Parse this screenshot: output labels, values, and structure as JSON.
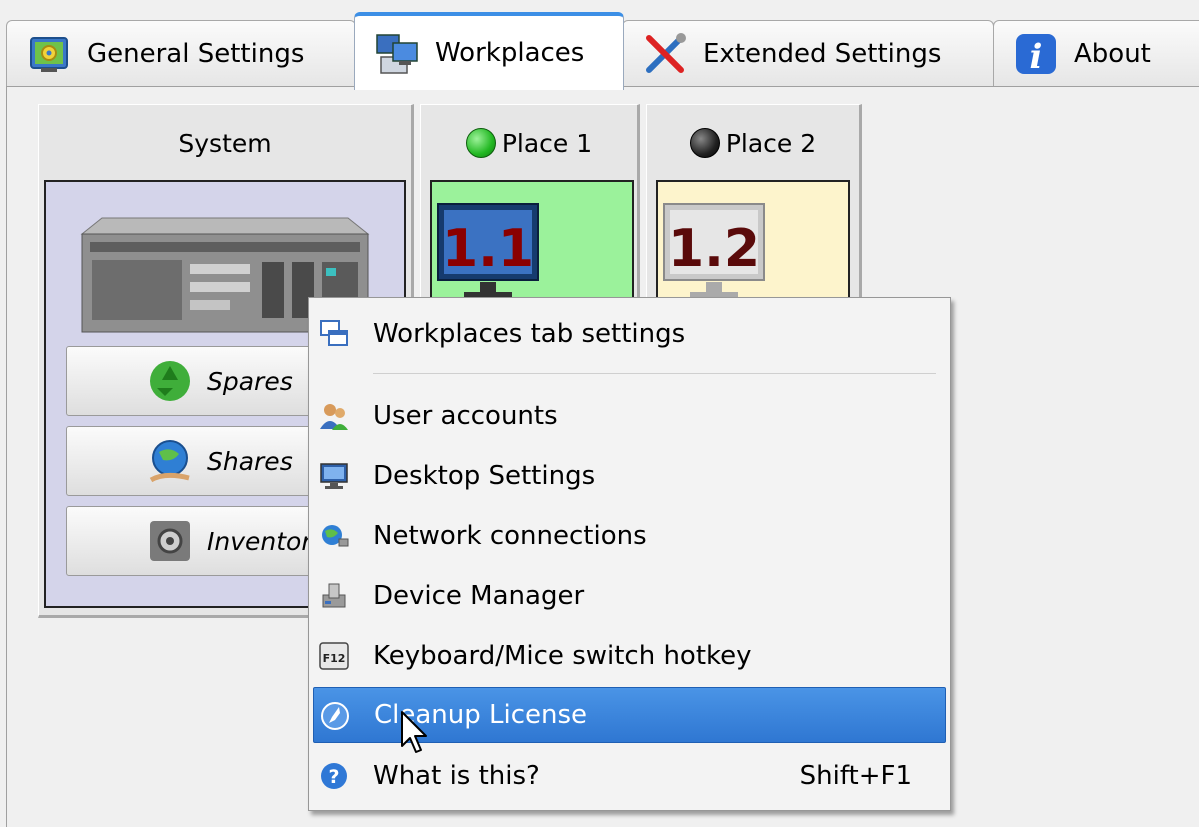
{
  "tabs": [
    {
      "label": "General Settings",
      "icon": "general-settings-icon"
    },
    {
      "label": "Workplaces",
      "icon": "workplaces-icon",
      "active": true
    },
    {
      "label": "Extended Settings",
      "icon": "tools-icon"
    },
    {
      "label": "About",
      "icon": "info-icon"
    }
  ],
  "system": {
    "title": "System",
    "buttons": [
      {
        "label": "Spares",
        "icon": "recycle-icon"
      },
      {
        "label": "Shares",
        "icon": "globe-hand-icon"
      },
      {
        "label": "Inventory",
        "icon": "gear-box-icon"
      }
    ]
  },
  "places": [
    {
      "title": "Place 1",
      "label": "1.1",
      "status": "active",
      "status_color": "#22b822",
      "bg": "#9bf29b"
    },
    {
      "title": "Place 2",
      "label": "1.2",
      "status": "inactive",
      "status_color": "#222222",
      "bg": "#fdf4cc"
    }
  ],
  "menu": {
    "items": [
      {
        "label": "Workplaces tab settings",
        "icon": "windows-stack-icon"
      },
      {
        "label": "User accounts",
        "icon": "users-icon"
      },
      {
        "label": "Desktop Settings",
        "icon": "monitor-icon"
      },
      {
        "label": "Network connections",
        "icon": "network-icon"
      },
      {
        "label": "Device Manager",
        "icon": "device-manager-icon"
      },
      {
        "label": "Keyboard/Mice switch hotkey",
        "icon": "f12-key-icon",
        "icon_text": "F12"
      },
      {
        "label": "Cleanup License",
        "icon": "broom-icon",
        "highlighted": true
      },
      {
        "label": "What is this?",
        "icon": "help-icon",
        "shortcut": "Shift+F1"
      }
    ]
  },
  "colors": {
    "accent": "#3c8fe6",
    "highlight": "#3a84dc",
    "system_bg": "#d4d4ea"
  }
}
